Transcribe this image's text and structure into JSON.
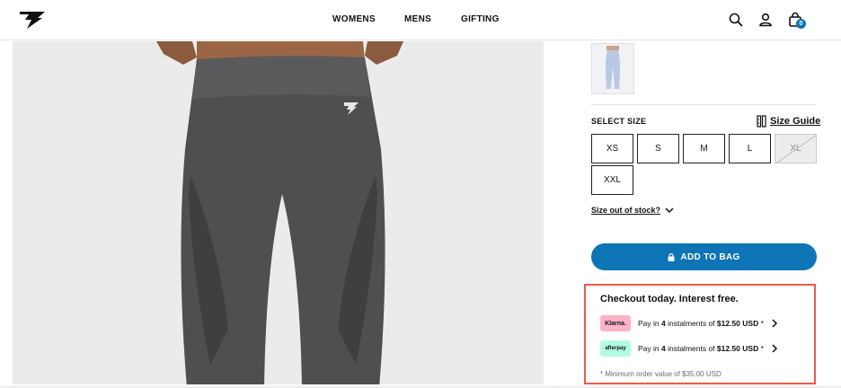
{
  "header": {
    "logo_icon": "gymshark-logo-icon",
    "nav": [
      {
        "label": "WOMENS"
      },
      {
        "label": "MENS"
      },
      {
        "label": "GIFTING"
      }
    ],
    "icons": [
      "search-icon",
      "account-icon",
      "bag-icon"
    ],
    "bag_count": "0"
  },
  "product": {
    "image": "grey seamless leggings on model",
    "thumbnail": "light blue leggings thumbnail"
  },
  "size_selector": {
    "label": "SELECT SIZE",
    "guide_label": "Size Guide",
    "sizes": [
      {
        "label": "XS",
        "available": true
      },
      {
        "label": "S",
        "available": true
      },
      {
        "label": "M",
        "available": true
      },
      {
        "label": "L",
        "available": true
      },
      {
        "label": "XL",
        "available": false
      },
      {
        "label": "XXL",
        "available": true
      }
    ],
    "oos_link": "Size out of stock?"
  },
  "cta": {
    "add_to_bag": "ADD TO BAG",
    "color": "#0d74b5"
  },
  "checkout": {
    "title": "Checkout today. Interest free.",
    "border_color": "#ec5b48",
    "options": [
      {
        "provider": "Klarna.",
        "badge_color": "#ffb3c7",
        "prefix": "Pay in ",
        "count": "4",
        "middle": " instalments of ",
        "amount": "$12.50 USD",
        "suffix": " *"
      },
      {
        "provider": "afterpay",
        "badge_color": "#b2fce4",
        "prefix": "Pay in ",
        "count": "4",
        "middle": " instalments of ",
        "amount": "$12.50 USD",
        "suffix": " *"
      }
    ],
    "footnote": "* Minimum order value of $35.00 USD"
  }
}
